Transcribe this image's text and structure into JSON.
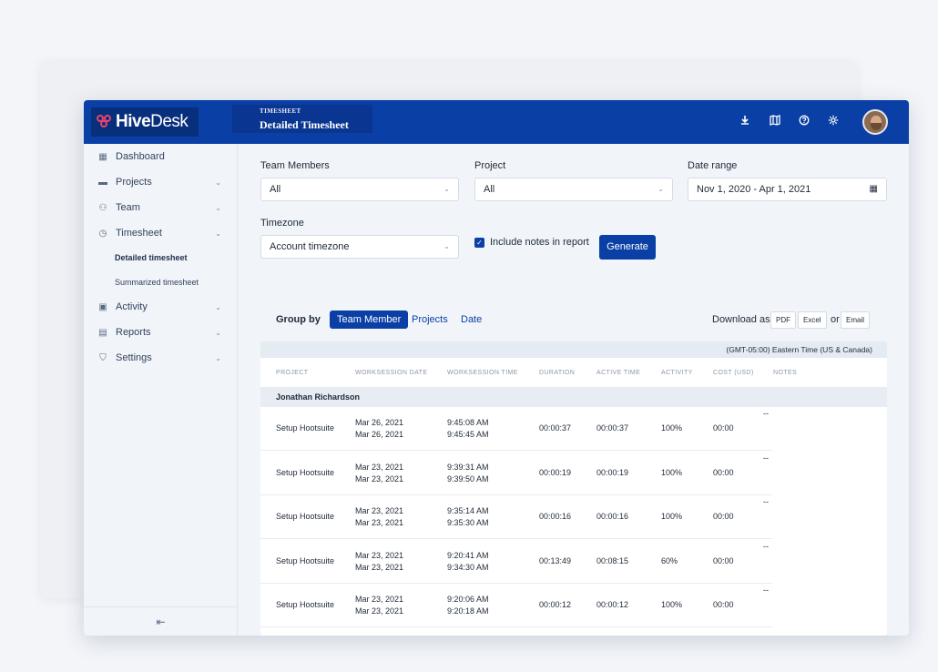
{
  "app": {
    "brand_bold": "Hive",
    "brand_regular": "Desk"
  },
  "header": {
    "section": "TIMESHEET",
    "title": "Detailed Timesheet",
    "icons": [
      "download-icon",
      "map-icon",
      "help-icon",
      "settings-icon"
    ]
  },
  "sidebar": {
    "items": [
      {
        "label": "Dashboard",
        "icon": "dashboard-icon"
      },
      {
        "label": "Projects",
        "icon": "folder-icon"
      },
      {
        "label": "Team",
        "icon": "team-icon"
      },
      {
        "label": "Timesheet",
        "icon": "timesheet-icon"
      },
      {
        "label": "Activity",
        "icon": "activity-icon"
      },
      {
        "label": "Reports",
        "icon": "reports-icon"
      },
      {
        "label": "Settings",
        "icon": "settings-icon"
      }
    ],
    "sub_items": [
      "Detailed timesheet",
      "Summarized timesheet"
    ]
  },
  "filters": {
    "team_members_label": "Team Members",
    "team_members_value": "All",
    "project_label": "Project",
    "project_value": "All",
    "date_range_label": "Date range",
    "date_range_value": "Nov 1, 2020 - Apr 1, 2021",
    "timezone_label": "Timezone",
    "timezone_value": "Account timezone",
    "include_notes_label": "Include notes in report",
    "generate_label": "Generate"
  },
  "report": {
    "group_by_label": "Group by",
    "group_options": [
      "Team Member",
      "Projects",
      "Date"
    ],
    "download_label": "Download as",
    "download_options": [
      "PDF",
      "Excel",
      "Email"
    ],
    "or_label": "or",
    "timezone_note": "(GMT-05:00) Eastern Time (US & Canada)",
    "columns": [
      "PROJECT",
      "WORKSESSION DATE",
      "WORKSESSION TIME",
      "DURATION",
      "ACTIVE TIME",
      "ACTIVITY",
      "COST (USD)",
      "NOTES"
    ],
    "member": "Jonathan Richardson",
    "rows": [
      {
        "project": "Setup Hootsuite",
        "date1": "Mar 26, 2021",
        "date2": "Mar 26, 2021",
        "time1": "9:45:08 AM",
        "time2": "9:45:45 AM",
        "duration": "00:00:37",
        "active": "00:00:37",
        "activity": "100%",
        "cost": "00:00",
        "notes": "--"
      },
      {
        "project": "Setup Hootsuite",
        "date1": "Mar 23, 2021",
        "date2": "Mar 23, 2021",
        "time1": "9:39:31 AM",
        "time2": "9:39:50 AM",
        "duration": "00:00:19",
        "active": "00:00:19",
        "activity": "100%",
        "cost": "00:00",
        "notes": "--"
      },
      {
        "project": "Setup Hootsuite",
        "date1": "Mar 23, 2021",
        "date2": "Mar 23, 2021",
        "time1": "9:35:14 AM",
        "time2": "9:35:30 AM",
        "duration": "00:00:16",
        "active": "00:00:16",
        "activity": "100%",
        "cost": "00:00",
        "notes": "--"
      },
      {
        "project": "Setup Hootsuite",
        "date1": "Mar 23, 2021",
        "date2": "Mar 23, 2021",
        "time1": "9:20:41 AM",
        "time2": "9:34:30 AM",
        "duration": "00:13:49",
        "active": "00:08:15",
        "activity": "60%",
        "cost": "00:00",
        "notes": "--"
      },
      {
        "project": "Setup Hootsuite",
        "date1": "Mar 23, 2021",
        "date2": "Mar 23, 2021",
        "time1": "9:20:06 AM",
        "time2": "9:20:18 AM",
        "duration": "00:00:12",
        "active": "00:00:12",
        "activity": "100%",
        "cost": "00:00",
        "notes": "--"
      }
    ]
  },
  "colors": {
    "brand": "#0a3fa5",
    "logo_accent": "#e8436a"
  }
}
